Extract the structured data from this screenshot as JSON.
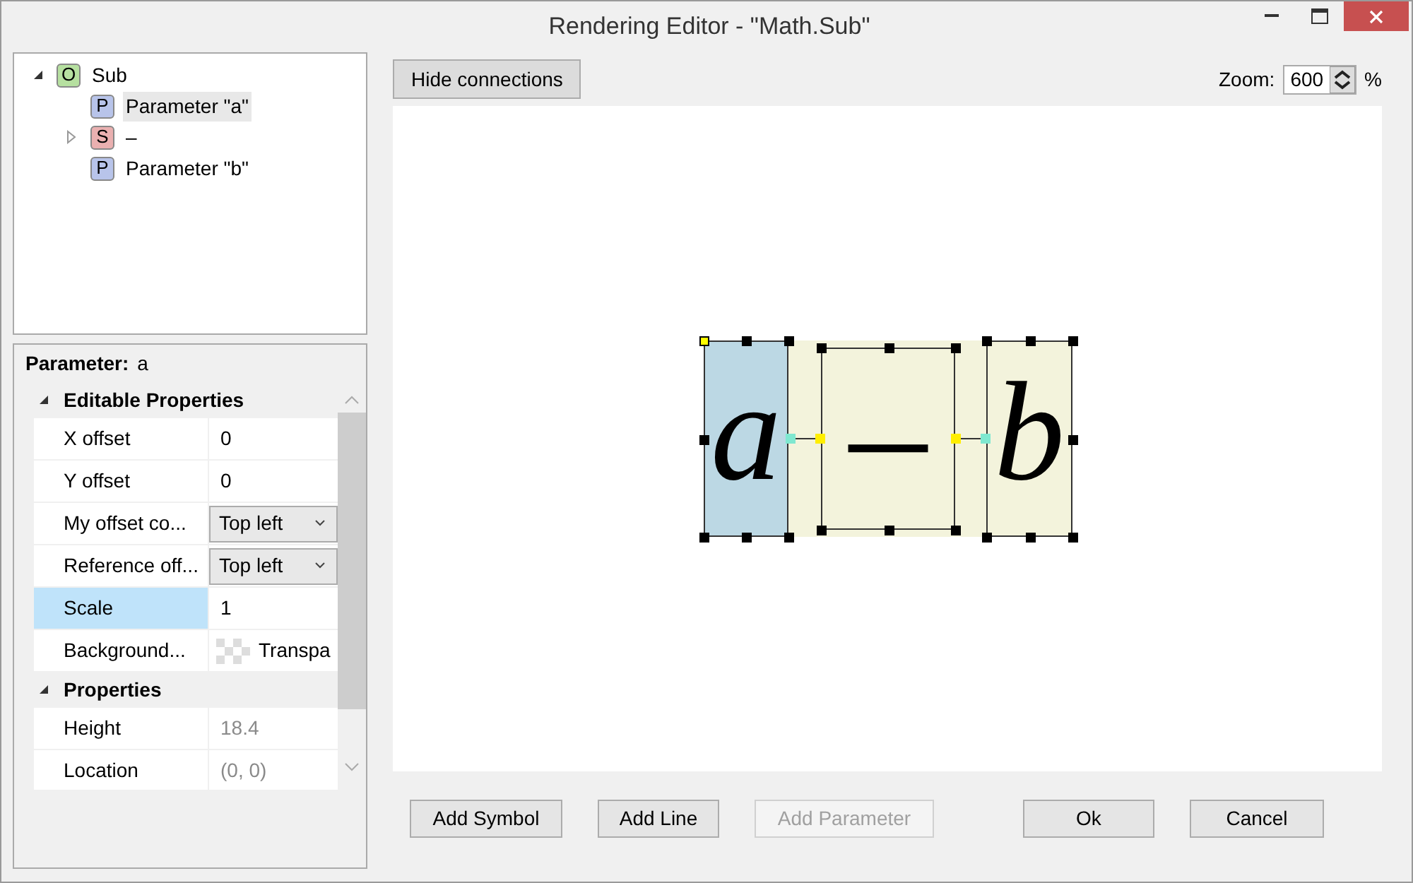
{
  "window": {
    "title": "Rendering Editor - \"Math.Sub\""
  },
  "tree": [
    {
      "badge": "O",
      "color": "#b6e0a0",
      "label": "Sub",
      "selected": false,
      "expanded": true,
      "children": [
        {
          "badge": "P",
          "color": "#b8c4ea",
          "label": "Parameter \"a\"",
          "selected": true
        },
        {
          "badge": "S",
          "color": "#eab0b0",
          "label": "–",
          "selected": false,
          "expanded": false
        },
        {
          "badge": "P",
          "color": "#b8c4ea",
          "label": "Parameter \"b\"",
          "selected": false
        }
      ]
    }
  ],
  "properties": {
    "header_label": "Parameter:",
    "header_value": "a",
    "categories": [
      {
        "name": "Editable Properties",
        "expanded": true,
        "rows": [
          {
            "name": "X offset",
            "value": "0",
            "kind": "text",
            "selected": false
          },
          {
            "name": "Y offset",
            "value": "0",
            "kind": "text",
            "selected": false
          },
          {
            "name": "My offset co...",
            "value": "Top left",
            "kind": "dropdown",
            "selected": false
          },
          {
            "name": "Reference off...",
            "value": "Top left",
            "kind": "dropdown",
            "selected": false
          },
          {
            "name": "Scale",
            "value": "1",
            "kind": "text",
            "selected": true
          },
          {
            "name": "Background...",
            "value": "Transpa",
            "kind": "color",
            "selected": false
          }
        ]
      },
      {
        "name": "Properties",
        "expanded": true,
        "rows": [
          {
            "name": "Height",
            "value": "18.4",
            "kind": "readonly",
            "selected": false
          },
          {
            "name": "Location",
            "value": "(0, 0)",
            "kind": "readonly",
            "selected": false
          }
        ]
      }
    ]
  },
  "toolbar": {
    "toggle_button": "Hide connections",
    "zoom_label": "Zoom:",
    "zoom_value": "600",
    "zoom_unit": "%"
  },
  "canvas": {
    "symbols": [
      {
        "glyph": "a",
        "selected": true
      },
      {
        "glyph": "–",
        "selected": false
      },
      {
        "glyph": "b",
        "selected": false
      }
    ]
  },
  "buttons": [
    {
      "label": "Add Symbol",
      "disabled": false
    },
    {
      "label": "Add Line",
      "disabled": false
    },
    {
      "label": "Add Parameter",
      "disabled": true
    },
    {
      "label": "Ok",
      "disabled": false
    },
    {
      "label": "Cancel",
      "disabled": false
    }
  ]
}
